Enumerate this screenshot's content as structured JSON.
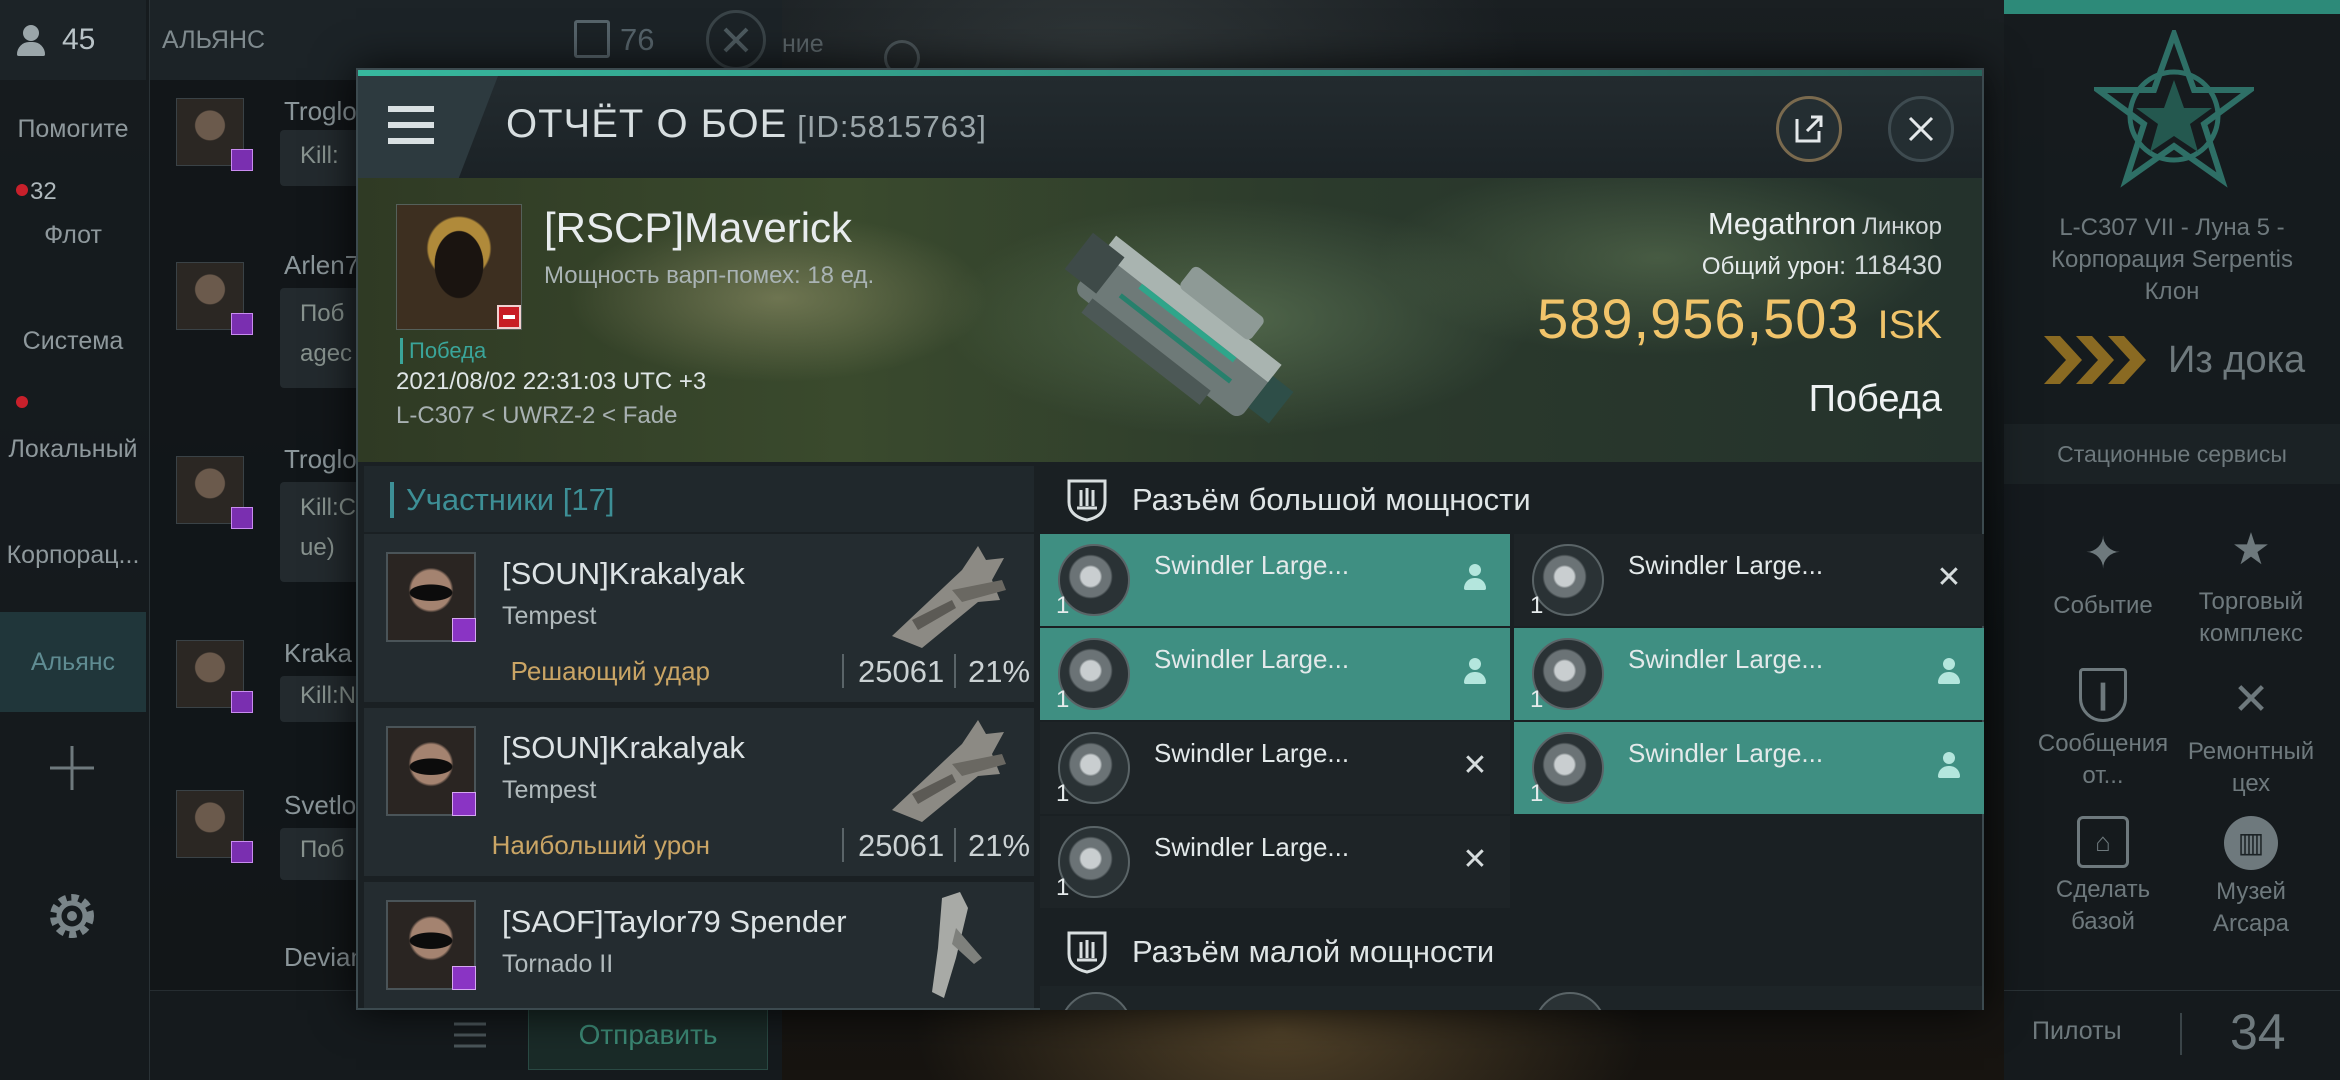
{
  "alliance_chat": {
    "online_count": "45",
    "header_title": "АЛЬЯНС",
    "message_count": "76",
    "header_tail_text": "ние",
    "nav": [
      {
        "label": "Помогите"
      },
      {
        "label": "Флот",
        "count": "32"
      },
      {
        "label": "Система"
      },
      {
        "label": "Локальный"
      },
      {
        "label": "Корпорац..."
      },
      {
        "label": "Альянс"
      }
    ],
    "messages": [
      {
        "name": "Troglo",
        "line1": "Kill:",
        "line2": ""
      },
      {
        "name": "Arlen7",
        "line1": "Поб",
        "line2": "agec"
      },
      {
        "name": "Troglo",
        "line1": "Kill:C",
        "line2": "ue)"
      },
      {
        "name": "Kraka",
        "line1": "Kill:N",
        "line2": ""
      },
      {
        "name": "Svetlo",
        "line1": "Поб",
        "line2": ""
      },
      {
        "name": "Devian",
        "line1": "",
        "line2": ""
      }
    ],
    "send_label": "Отправить"
  },
  "station": {
    "location": "L-C307 VII - Луна 5 - Корпорация Serpentis Клон",
    "undock_label": "Из дока",
    "services_title": "Стационные сервисы",
    "services": [
      {
        "label": "Событие",
        "icon": "party-popper-icon"
      },
      {
        "label": "Торговый комплекс",
        "icon": "nes-star-icon"
      },
      {
        "label": "Сообщения от...",
        "icon": "shield-message-icon"
      },
      {
        "label": "Ремонтный цех",
        "icon": "wrench-icon"
      },
      {
        "label": "Сделать базой",
        "icon": "home-base-icon"
      },
      {
        "label": "Музей Arcapa",
        "icon": "museum-icon"
      }
    ],
    "pilots_label": "Пилоты",
    "pilots_count": "34"
  },
  "report": {
    "title": "ОТЧЁТ О БОЕ",
    "id": "[ID:5815763]",
    "victim": {
      "name": "[RSCP]Maverick",
      "warp_strength": "Мощность варп-помех: 18 ед.",
      "tag": "Победа",
      "date": "2021/08/02 22:31:03 UTC +3",
      "route": "L-C307 < UWRZ-2 < Fade",
      "ship": "Megathron",
      "ship_class": "Линкор",
      "total_damage_label": "Общий урон:",
      "total_damage": "118430",
      "isk_value": "589,956,503",
      "isk_unit": "ISK",
      "result": "Победа"
    },
    "participants_label": "Участники",
    "participants_count": "[17]",
    "participants": [
      {
        "name": "[SOUN]Krakalyak",
        "ship": "Tempest",
        "role": "Решающий удар",
        "damage": "25061",
        "percent": "21%"
      },
      {
        "name": "[SOUN]Krakalyak",
        "ship": "Tempest",
        "role": "Наибольший урон",
        "damage": "25061",
        "percent": "21%"
      },
      {
        "name": "[SAOF]Taylor79 Spender",
        "ship": "Tornado II",
        "role": "",
        "damage": "",
        "percent": ""
      }
    ],
    "high_slots_label": "Разъём большой мощности",
    "low_slots_label": "Разъём малой мощности",
    "high_slots": [
      {
        "name": "Swindler Large...",
        "qty": "1",
        "status": "fitted"
      },
      {
        "name": "Swindler Large...",
        "qty": "1",
        "status": "destroyed"
      },
      {
        "name": "Swindler Large...",
        "qty": "1",
        "status": "fitted"
      },
      {
        "name": "Swindler Large...",
        "qty": "1",
        "status": "fitted"
      },
      {
        "name": "Swindler Large...",
        "qty": "1",
        "status": "destroyed"
      },
      {
        "name": "Swindler Large...",
        "qty": "1",
        "status": "fitted"
      },
      {
        "name": "Swindler Large...",
        "qty": "1",
        "status": "destroyed"
      }
    ]
  }
}
